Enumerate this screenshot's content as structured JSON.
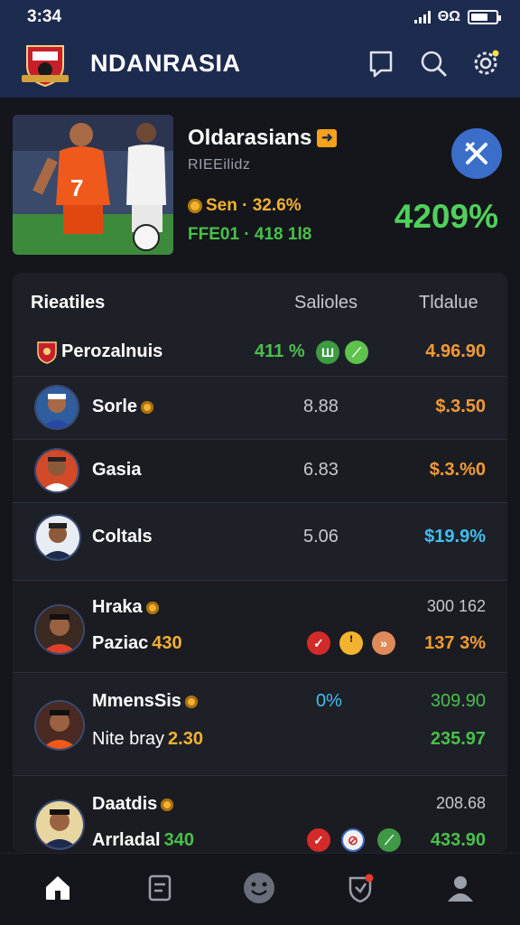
{
  "status_bar": {
    "time": "3:34",
    "carrier": "ΘΩ"
  },
  "app": {
    "title": "NDANRASIA"
  },
  "icons": {
    "logo": "club-crest-icon",
    "bookmark": "bookmark-icon",
    "search": "search-icon",
    "settings": "gear-icon",
    "hero_action": "crossed-tools-icon"
  },
  "hero": {
    "title": "Oldarasians",
    "badge": "➜",
    "subtitle": "RIEEilidz",
    "stat1": "Sen · 32.6%",
    "stat2": "FFE01 · 418 1l8",
    "percent": "4209%"
  },
  "table": {
    "headers": [
      "Rieatiles",
      "Salioles",
      "Tldalue"
    ],
    "rows": [
      {
        "name": "Perozalnuis",
        "mid": "411 %",
        "value": "4.96.90"
      },
      {
        "name": "Sorle",
        "mid": "8.88",
        "value": "$.3.50"
      },
      {
        "name": "Gasia",
        "mid": "6.83",
        "value": "$.3.%0"
      },
      {
        "name": "Coltals",
        "mid": "5.06",
        "value": "$19.9%"
      },
      {
        "name": "Hraka",
        "sub_name": "Paziac",
        "sub_num": "430",
        "top_value": "300 162",
        "value": "137 3%"
      },
      {
        "name": "MmensSis",
        "sub_name": "Nite bray",
        "sub_num": "2.30",
        "mid": "0%",
        "top_value": "309.90",
        "value": "235.97"
      },
      {
        "name": "Daatdis",
        "sub_name": "Arrladal",
        "sub_num": "340",
        "top_value": "208.68",
        "value": "433.90"
      }
    ]
  },
  "colors": {
    "topbar": "#1d2b4f",
    "background": "#15161b",
    "card": "#1e2028",
    "green": "#49c04a",
    "orange": "#f39b35",
    "cyan": "#3fc0f0",
    "gold": "#f3b230"
  },
  "bottom_nav": [
    "home-icon",
    "document-icon",
    "smiley-icon",
    "shield-notify-icon",
    "profile-icon"
  ]
}
